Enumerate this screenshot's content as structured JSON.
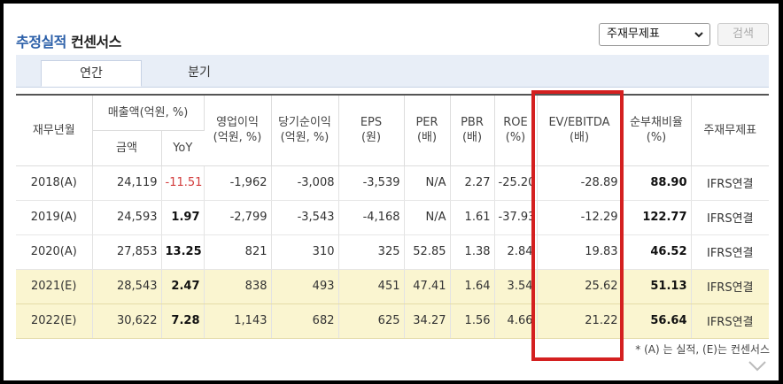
{
  "header": {
    "title_blue": "추정실적",
    "title_dark": "컨센서스"
  },
  "controls": {
    "standard_select": "주재무제표",
    "search_label": "검색"
  },
  "tabs": [
    {
      "label": "연간",
      "active": true
    },
    {
      "label": "분기",
      "active": false
    }
  ],
  "table": {
    "headers": {
      "period": "재무년월",
      "sales_group": "매출액(억원, %)",
      "sales_amount": "금액",
      "sales_yoy": "YoY",
      "op_income": "영업이익",
      "op_income_unit": "(억원, %)",
      "net_income": "당기순이익",
      "net_income_unit": "(억원, %)",
      "eps": "EPS",
      "eps_unit": "(원)",
      "per": "PER",
      "per_unit": "(배)",
      "pbr": "PBR",
      "pbr_unit": "(배)",
      "roe": "ROE",
      "roe_unit": "(%)",
      "ev_ebitda": "EV/EBITDA",
      "ev_ebitda_unit": "(배)",
      "net_debt_ratio": "순부채비율",
      "net_debt_ratio_unit": "(%)",
      "standard": "주재무제표"
    },
    "rows": [
      {
        "period": "2018(A)",
        "sales": "24,119",
        "yoy": "-11.51",
        "op": "-1,962",
        "net": "-3,008",
        "eps": "-3,539",
        "per": "N/A",
        "pbr": "2.27",
        "roe": "-25.20",
        "ev": "-28.89",
        "ndr": "88.90",
        "std": "IFRS연결"
      },
      {
        "period": "2019(A)",
        "sales": "24,593",
        "yoy": "1.97",
        "op": "-2,799",
        "net": "-3,543",
        "eps": "-4,168",
        "per": "N/A",
        "pbr": "1.61",
        "roe": "-37.93",
        "ev": "-12.29",
        "ndr": "122.77",
        "std": "IFRS연결"
      },
      {
        "period": "2020(A)",
        "sales": "27,853",
        "yoy": "13.25",
        "op": "821",
        "net": "310",
        "eps": "325",
        "per": "52.85",
        "pbr": "1.38",
        "roe": "2.84",
        "ev": "19.83",
        "ndr": "46.52",
        "std": "IFRS연결"
      },
      {
        "period": "2021(E)",
        "sales": "28,543",
        "yoy": "2.47",
        "op": "838",
        "net": "493",
        "eps": "451",
        "per": "47.41",
        "pbr": "1.64",
        "roe": "3.54",
        "ev": "25.62",
        "ndr": "51.13",
        "std": "IFRS연결"
      },
      {
        "period": "2022(E)",
        "sales": "30,622",
        "yoy": "7.28",
        "op": "1,143",
        "net": "682",
        "eps": "625",
        "per": "34.27",
        "pbr": "1.56",
        "roe": "4.66",
        "ev": "21.22",
        "ndr": "56.64",
        "std": "IFRS연결"
      }
    ]
  },
  "footnote": "* (A) 는 실적, (E)는 컨센서스",
  "colors": {
    "title_blue": "#2a5ea8",
    "negative": "#d23b3b",
    "estimate_row_bg": "#faf5d0",
    "highlight_border": "#d42020"
  }
}
